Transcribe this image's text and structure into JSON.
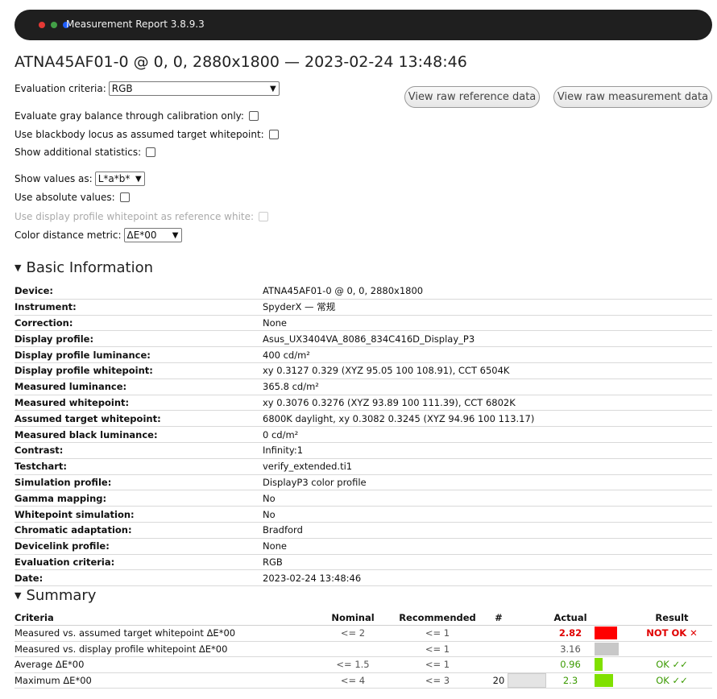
{
  "window": {
    "title": "Measurement Report 3.8.9.3",
    "dots": [
      "#e53935",
      "#43a047",
      "#1e5eff"
    ]
  },
  "report_title": "ATNA45AF01-0 @ 0, 0, 2880x1800 — 2023-02-24 13:48:46",
  "controls": {
    "eval_label": "Evaluation criteria:",
    "eval_value": "RGB",
    "gray_balance_label": "Evaluate gray balance through calibration only:",
    "blackbody_label": "Use blackbody locus as assumed target whitepoint:",
    "additional_stats_label": "Show additional statistics:",
    "show_values_label": "Show values as:",
    "show_values_value": "L*a*b*",
    "absolute_label": "Use absolute values:",
    "profile_wp_label": "Use display profile whitepoint as reference white:",
    "distance_label": "Color distance metric:",
    "distance_value": "ΔE*00"
  },
  "buttons": {
    "raw_ref": "View raw reference data",
    "raw_meas": "View raw measurement data"
  },
  "basic": {
    "heading": "Basic Information",
    "rows": [
      {
        "k": "Device:",
        "v": "ATNA45AF01-0 @ 0, 0, 2880x1800"
      },
      {
        "k": "Instrument:",
        "v": "SpyderX — 常规"
      },
      {
        "k": "Correction:",
        "v": "None"
      },
      {
        "k": "Display profile:",
        "v": "Asus_UX3404VA_8086_834C416D_Display_P3"
      },
      {
        "k": "Display profile luminance:",
        "v": "400 cd/m²"
      },
      {
        "k": "Display profile whitepoint:",
        "v": "xy 0.3127 0.329 (XYZ 95.05 100 108.91), CCT 6504K"
      },
      {
        "k": "Measured luminance:",
        "v": "365.8 cd/m²"
      },
      {
        "k": "Measured whitepoint:",
        "v": "xy 0.3076 0.3276 (XYZ 93.89 100 111.39), CCT 6802K"
      },
      {
        "k": "Assumed target whitepoint:",
        "v": "6800K daylight, xy 0.3082 0.3245 (XYZ 94.96 100 113.17)"
      },
      {
        "k": "Measured black luminance:",
        "v": "0 cd/m²"
      },
      {
        "k": "Contrast:",
        "v": "Infinity:1"
      },
      {
        "k": "Testchart:",
        "v": "verify_extended.ti1"
      },
      {
        "k": "Simulation profile:",
        "v": "DisplayP3 color profile"
      },
      {
        "k": "Gamma mapping:",
        "v": "No"
      },
      {
        "k": "Whitepoint simulation:",
        "v": "No"
      },
      {
        "k": "Chromatic adaptation:",
        "v": "Bradford"
      },
      {
        "k": "Devicelink profile:",
        "v": "None"
      },
      {
        "k": "Evaluation criteria:",
        "v": "RGB"
      },
      {
        "k": "Date:",
        "v": "2023-02-24 13:48:46"
      }
    ]
  },
  "summary": {
    "heading": "Summary",
    "headers": {
      "criteria": "Criteria",
      "nominal": "Nominal",
      "recommended": "Recommended",
      "count": "#",
      "actual": "Actual",
      "result": "Result"
    },
    "rows": [
      {
        "criteria": "Measured vs. assumed target whitepoint ΔE*00",
        "nominal": "<= 2",
        "recommended": "<= 1",
        "count": "",
        "actual": "2.82",
        "actual_level": 0.94,
        "result": "NOT OK ✕",
        "status": "fail"
      },
      {
        "criteria": "Measured vs. display profile whitepoint ΔE*00",
        "nominal": "",
        "recommended": "<= 1",
        "count": "",
        "actual": "3.16",
        "actual_level": 1.0,
        "result": "",
        "status": "none"
      },
      {
        "criteria": "Average ΔE*00",
        "nominal": "<= 1.5",
        "recommended": "<= 1",
        "count": "",
        "actual": "0.96",
        "actual_level": 0.32,
        "result": "OK ✓✓",
        "status": "ok"
      },
      {
        "criteria": "Maximum ΔE*00",
        "nominal": "<= 4",
        "recommended": "<= 3",
        "count": "20",
        "actual": "2.3",
        "actual_level": 0.77,
        "result": "OK ✓✓",
        "status": "ok"
      }
    ]
  },
  "colors": {
    "fail": "#ff0000",
    "ok": "#80e000",
    "none": "#c8c8c8"
  }
}
